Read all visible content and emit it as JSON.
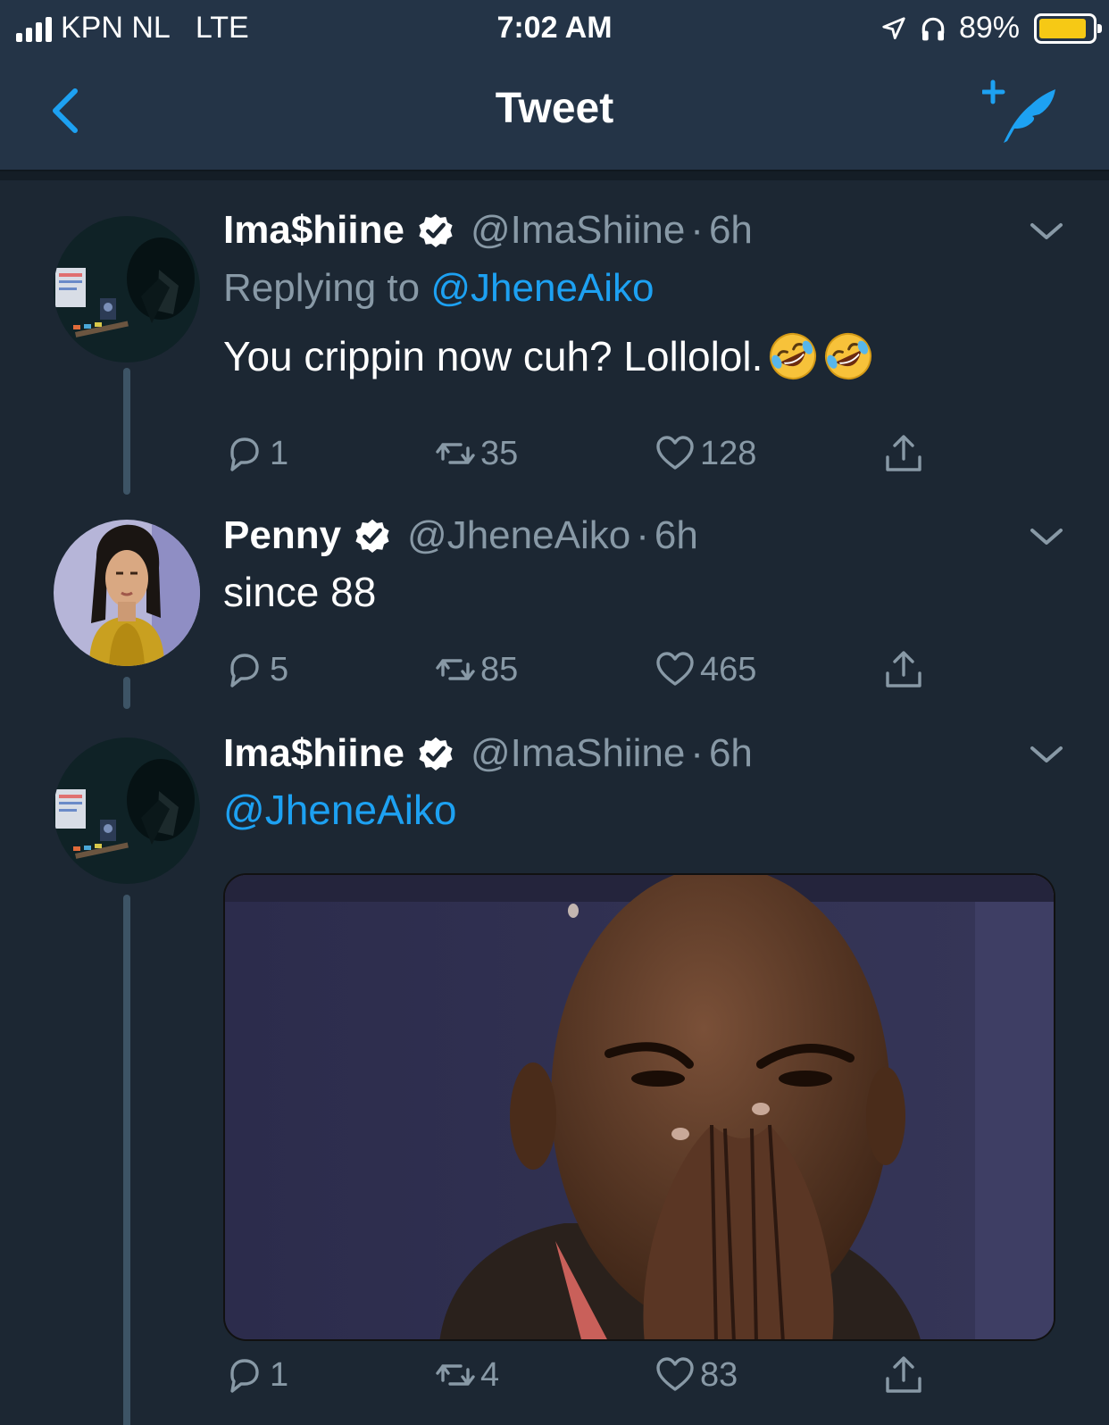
{
  "status_bar": {
    "carrier": "KPN NL",
    "network": "LTE",
    "time": "7:02 AM",
    "battery_percent": "89%",
    "battery_level": 0.89,
    "icons": [
      "signal-icon",
      "location-arrow-icon",
      "headphones-icon",
      "battery-icon"
    ]
  },
  "nav": {
    "title": "Tweet",
    "back_icon": "chevron-left-icon",
    "compose_icon": "compose-tweet-icon"
  },
  "tweets": [
    {
      "display_name": "Ima$hiine",
      "verified": true,
      "handle": "@ImaShiine",
      "separator": "·",
      "time": "6h",
      "reply_prefix": "Replying to",
      "reply_to": "@JheneAiko",
      "text": "You crippin now cuh? Lollolol.",
      "emojis": [
        "rolling-on-floor-laughing-emoji",
        "rolling-on-floor-laughing-emoji"
      ],
      "replies": "1",
      "retweets": "35",
      "likes": "128"
    },
    {
      "display_name": "Penny",
      "verified": true,
      "handle": "@JheneAiko",
      "separator": "·",
      "time": "6h",
      "text": "since 88",
      "replies": "5",
      "retweets": "85",
      "likes": "465"
    },
    {
      "display_name": "Ima$hiine",
      "verified": true,
      "handle": "@ImaShiine",
      "separator": "·",
      "time": "6h",
      "mention": "@JheneAiko",
      "media": "photo",
      "replies": "1",
      "retweets": "4",
      "likes": "83"
    }
  ],
  "colors": {
    "background": "#1c2733",
    "header": "#243447",
    "accent": "#1da1f2",
    "secondary_text": "#8899a6",
    "battery": "#f6c915"
  }
}
